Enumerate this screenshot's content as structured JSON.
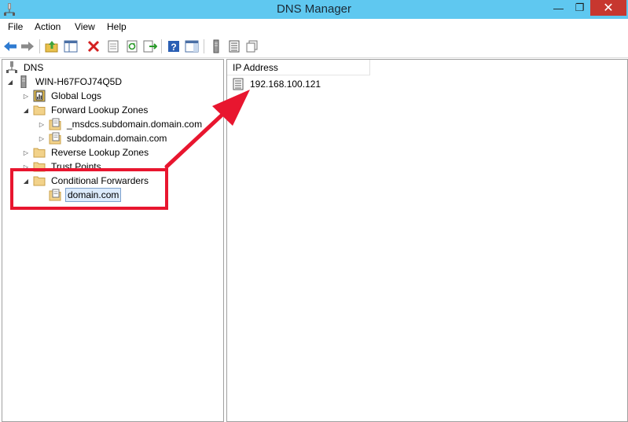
{
  "window": {
    "title": "DNS Manager",
    "controls": {
      "minimize": "—",
      "maximize": "❐",
      "close": "✕"
    }
  },
  "menu": {
    "items": [
      {
        "label": "File"
      },
      {
        "label": "Action"
      },
      {
        "label": "View"
      },
      {
        "label": "Help"
      }
    ]
  },
  "toolbar": {
    "buttons": [
      "back-icon",
      "forward-icon",
      "up-level-icon",
      "show-hide-console-tree-icon",
      "delete-icon",
      "properties-icon",
      "refresh-icon",
      "export-list-icon",
      "help-icon",
      "show-action-pane-icon",
      "server-icon",
      "zone-icon",
      "forwarder-icon"
    ]
  },
  "tree": {
    "root": {
      "label": "DNS"
    },
    "server": {
      "label": "WIN-H67FOJ74Q5D"
    },
    "global_logs": {
      "label": "Global Logs"
    },
    "forward_zones": {
      "label": "Forward Lookup Zones"
    },
    "msdcs_zone": {
      "label": "_msdcs.subdomain.domain.com"
    },
    "subdomain_zone": {
      "label": "subdomain.domain.com"
    },
    "reverse_zones": {
      "label": "Reverse Lookup Zones"
    },
    "trust_points": {
      "label": "Trust Points"
    },
    "conditional_forwarders": {
      "label": "Conditional Forwarders"
    },
    "forwarder_domain": {
      "label": "domain.com"
    }
  },
  "list": {
    "column_header": "IP Address",
    "rows": [
      {
        "ip": "192.168.100.121"
      }
    ]
  },
  "annotations": {
    "highlight_color": "#e8162f",
    "arrow_color": "#e8162f"
  }
}
